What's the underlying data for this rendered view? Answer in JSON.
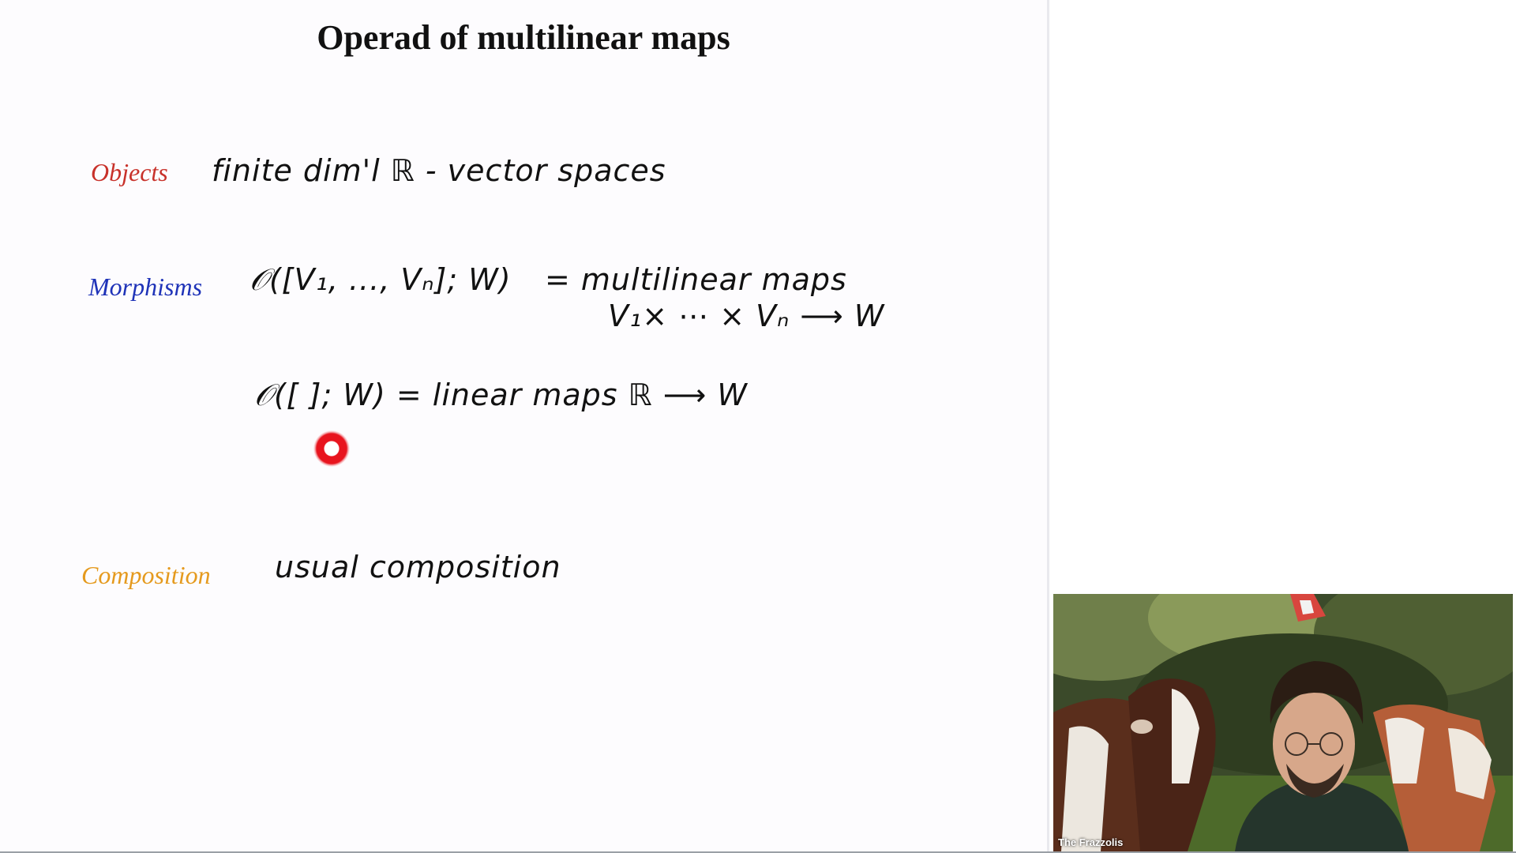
{
  "slide": {
    "title": "Operad of multilinear maps",
    "objects": {
      "label": "Objects",
      "label_color": "#c8312a",
      "text": "finite dim'l ℝ - vector spaces"
    },
    "morphisms": {
      "label": "Morphisms",
      "label_color": "#1f33b8",
      "line1_lhs": "𝒪([V₁, ..., Vₙ]; W)",
      "line1_rhs": "= multilinear maps",
      "line2": "V₁× ⋯ × Vₙ ⟶ W",
      "line3": "𝒪([ ]; W) = linear maps ℝ ⟶ W"
    },
    "composition": {
      "label": "Composition",
      "label_color": "#e59a1e",
      "text": "usual composition"
    }
  },
  "pointer": {
    "color": "#e8141e"
  },
  "webcam": {
    "participant_name": "The Frazzolis"
  }
}
